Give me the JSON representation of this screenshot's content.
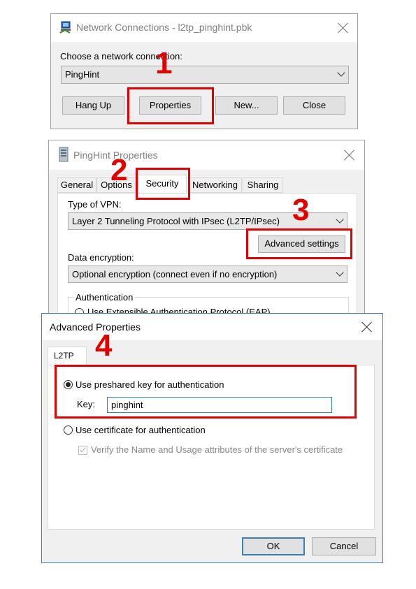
{
  "network_connections": {
    "title": "Network Connections - l2tp_pinghint.pbk",
    "choose_label": "Choose a network connection:",
    "selected_connection": "PingHint",
    "buttons": {
      "hang_up": "Hang Up",
      "properties": "Properties",
      "new": "New...",
      "close": "Close"
    }
  },
  "pinghint_properties": {
    "title": "PingHint Properties",
    "tabs": [
      "General",
      "Options",
      "Security",
      "Networking",
      "Sharing"
    ],
    "active_tab": "Security",
    "vpn_type_label": "Type of VPN:",
    "vpn_type_value": "Layer 2 Tunneling Protocol with IPsec (L2TP/IPsec)",
    "advanced_settings_button": "Advanced settings",
    "data_encryption_label": "Data encryption:",
    "data_encryption_value": "Optional encryption (connect even if no encryption)",
    "authentication_group_label": "Authentication",
    "eap_option_label": "Use Extensible Authentication Protocol (EAP)"
  },
  "advanced_properties": {
    "title": "Advanced Properties",
    "tab": "L2TP",
    "preshared_key_option": "Use preshared key for authentication",
    "key_label": "Key:",
    "key_value": "pinghint",
    "certificate_option": "Use certificate for authentication",
    "verify_option": "Verify the Name and Usage attributes of the server's certificate",
    "ok_button": "OK",
    "cancel_button": "Cancel"
  },
  "annotations": {
    "step1": "1",
    "step2": "2",
    "step3": "3",
    "step4": "4",
    "highlight_color": "#e00000"
  },
  "icons": {
    "network_connections": "network-connections-icon",
    "properties": "computer-tower-icon"
  }
}
